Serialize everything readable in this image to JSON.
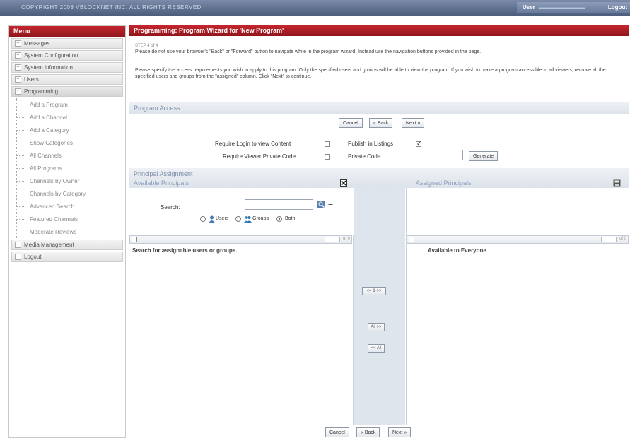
{
  "topbar": {
    "copyright": "COPYRIGHT 2008 VBLOCKNET INC. ALL RIGHTS RESERVED",
    "user_label": "User",
    "logout": "Logout"
  },
  "sidebar": {
    "title": "Menu",
    "items": [
      {
        "sign": "+",
        "label": "Messages"
      },
      {
        "sign": "+",
        "label": "System Configuration"
      },
      {
        "sign": "+",
        "label": "System Information"
      },
      {
        "sign": "+",
        "label": "Users"
      },
      {
        "sign": "-",
        "label": "Programming"
      }
    ],
    "programming_children": [
      "Add a Program",
      "Add a Channel",
      "Add a Category",
      "Show Categories",
      "All Channels",
      "All Programs",
      "Channels by Owner",
      "Channels by Category",
      "Advanced Search",
      "Featured Channels",
      "Moderate Reviews"
    ],
    "bottom_items": [
      {
        "sign": "+",
        "label": "Media Management"
      },
      {
        "sign": "+",
        "label": "Logout"
      }
    ]
  },
  "main": {
    "title": "Programming: Program Wizard for 'New Program'",
    "step": "STEP 4 of 4",
    "intro1": "Please do not use your browser's \"Back\" or \"Forward\" button to navigate while in the program wizard. Instead use the navigation buttons provided in the page.",
    "intro2": "Please specify the access requirements you wish to apply to this program. Only the specified users and groups will be able to view the program. If you wish to make a program accessible to all viewers, remove all the specified users and groups from the \"assigned\" column. Click \"Next\" to continue.",
    "section_program_access": "Program Access",
    "buttons": {
      "cancel": "Cancel",
      "back": "« Back",
      "next": "Next »"
    },
    "require_login": "Require Login to view Content",
    "publish_listings": "Publish in Listings",
    "require_private_code": "Require Viewer Private Code",
    "private_code_label": "Private Code",
    "generate": "Generate",
    "section_principal": "Principal Assignment",
    "available_title": "Available Principals",
    "assigned_title": "Assigned Principals",
    "search_label": "Search:",
    "radio_users": "Users",
    "radio_groups": "Groups",
    "radio_both": "Both",
    "left_pager": "of 0",
    "right_pager": "of 0",
    "left_message": "Search for assignable users or groups.",
    "right_message": "Available to Everyone",
    "move_buttons": {
      "swap": "<< & >>",
      "all_right": "All >>",
      "all_left": "<< All"
    }
  }
}
